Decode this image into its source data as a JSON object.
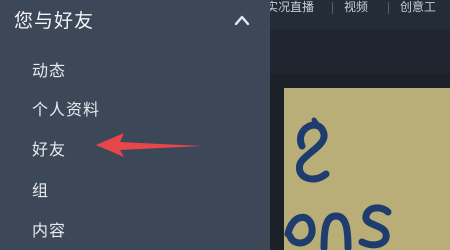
{
  "sidebar": {
    "title": "您与好友",
    "items": [
      {
        "label": "动态"
      },
      {
        "label": "个人资料"
      },
      {
        "label": "好友"
      },
      {
        "label": "组"
      },
      {
        "label": "内容"
      }
    ]
  },
  "topbar": {
    "tabs": [
      {
        "label": "实况直播"
      },
      {
        "label": "视频"
      },
      {
        "label": "创意工"
      }
    ]
  },
  "colors": {
    "sidebar_bg": "#3c4758",
    "arrow": "#e8474a",
    "poster_bg": "#b9ae78",
    "poster_ink": "#1f3c6e"
  },
  "icons": {
    "collapse": "chevron-up-icon",
    "annotation": "red-arrow-icon"
  }
}
